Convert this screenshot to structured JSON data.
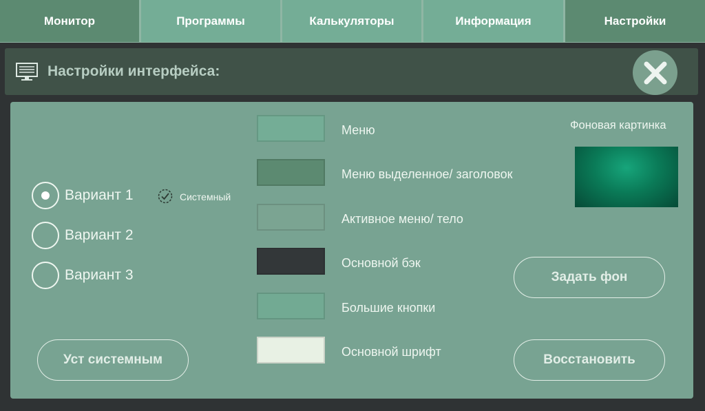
{
  "nav": {
    "tabs": [
      {
        "label": "Монитор"
      },
      {
        "label": "Программы"
      },
      {
        "label": "Калькуляторы"
      },
      {
        "label": "Информация"
      },
      {
        "label": "Настройки"
      }
    ]
  },
  "header": {
    "title": "Настройки интерфейса:",
    "icon": "monitor-icon",
    "close_icon": "close-icon"
  },
  "variants": {
    "options": [
      {
        "label": "Вариант 1",
        "selected": true
      },
      {
        "label": "Вариант 2",
        "selected": false
      },
      {
        "label": "Вариант 3",
        "selected": false
      }
    ],
    "system_label": "Системный",
    "set_system_button": "Уст системным"
  },
  "colors": {
    "items": [
      {
        "label": "Меню",
        "color": "#74ad96"
      },
      {
        "label": "Меню выделенное/ заголовок",
        "color": "#5c8a71"
      },
      {
        "label": "Активное меню/ тело",
        "color": "#7ba492"
      },
      {
        "label": "Основной бэк",
        "color": "#333739"
      },
      {
        "label": "Большие кнопки",
        "color": "#72aa93"
      },
      {
        "label": "Основной шрифт",
        "color": "#e8f1e4"
      }
    ]
  },
  "background": {
    "label": "Фоновая картинка",
    "set_button": "Задать фон",
    "restore_button": "Восстановить"
  }
}
